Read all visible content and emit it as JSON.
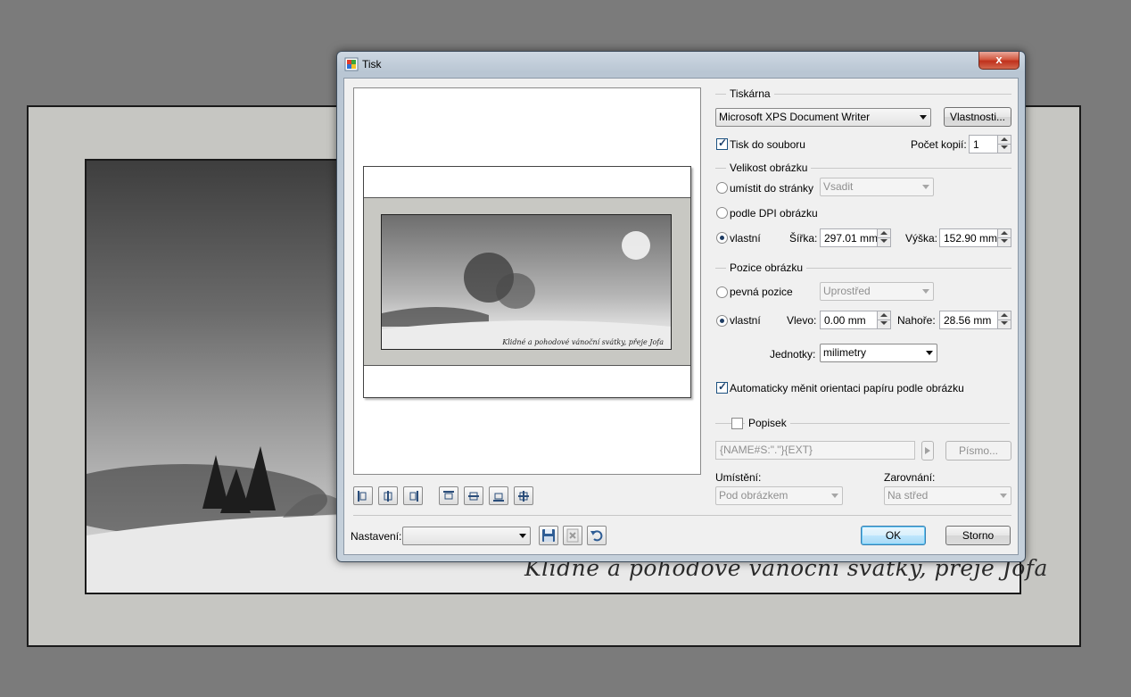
{
  "background": {
    "caption": "Klidné a pohodové vánoční svátky,  přeje Jofa"
  },
  "window": {
    "title": "Tisk",
    "close_label": "x",
    "title_icon": "print-app-icon"
  },
  "preview": {
    "caption": "Klidné a pohodové vánoční svátky,  přeje Jofa",
    "align_buttons": [
      "align-left-icon",
      "align-center-horizontal-icon",
      "align-right-icon",
      "align-top-icon",
      "align-center-vertical-icon",
      "align-bottom-icon",
      "align-center-icon"
    ]
  },
  "printer": {
    "group_label": "Tiskárna",
    "selected": "Microsoft XPS Document Writer",
    "properties_button": "Vlastnosti...",
    "print_to_file_label": "Tisk do souboru",
    "print_to_file_checked": true,
    "copies_label": "Počet kopií:",
    "copies_value": "1"
  },
  "size": {
    "group_label": "Velikost obrázku",
    "fit_page_label": "umístit do stránky",
    "fit_page_combo": "Vsadit",
    "dpi_label": "podle DPI obrázku",
    "custom_label": "vlastní",
    "selected_option": "vlastní",
    "width_label": "Šířka:",
    "width_value": "297.01 mm",
    "height_label": "Výška:",
    "height_value": "152.90 mm"
  },
  "position": {
    "group_label": "Pozice obrázku",
    "fixed_label": "pevná pozice",
    "fixed_combo": "Uprostřed",
    "custom_label": "vlastní",
    "selected_option": "vlastní",
    "left_label": "Vlevo:",
    "left_value": "0.00 mm",
    "top_label": "Nahoře:",
    "top_value": "28.56 mm",
    "units_label": "Jednotky:",
    "units_value": "milimetry"
  },
  "auto_orientation": {
    "label": "Automaticky měnit orientaci papíru podle obrázku",
    "checked": true
  },
  "caption_group": {
    "label": "Popisek",
    "checked": false,
    "template_value": "{NAME#S:\".\"}{EXT}",
    "font_button": "Písmo...",
    "placement_label": "Umístění:",
    "placement_value": "Pod obrázkem",
    "alignment_label": "Zarovnání:",
    "alignment_value": "Na střed"
  },
  "footer": {
    "settings_label": "Nastavení:",
    "settings_value": "",
    "save_icon": "save-icon",
    "delete_icon": "delete-preset-icon",
    "revert_icon": "revert-icon",
    "ok_label": "OK",
    "cancel_label": "Storno"
  },
  "colors": {
    "desktop": "#7b7b7b",
    "dialog_face": "#f0f0f0",
    "close_red": "#c0311c",
    "default_button_blue": "#3c7fb1"
  }
}
